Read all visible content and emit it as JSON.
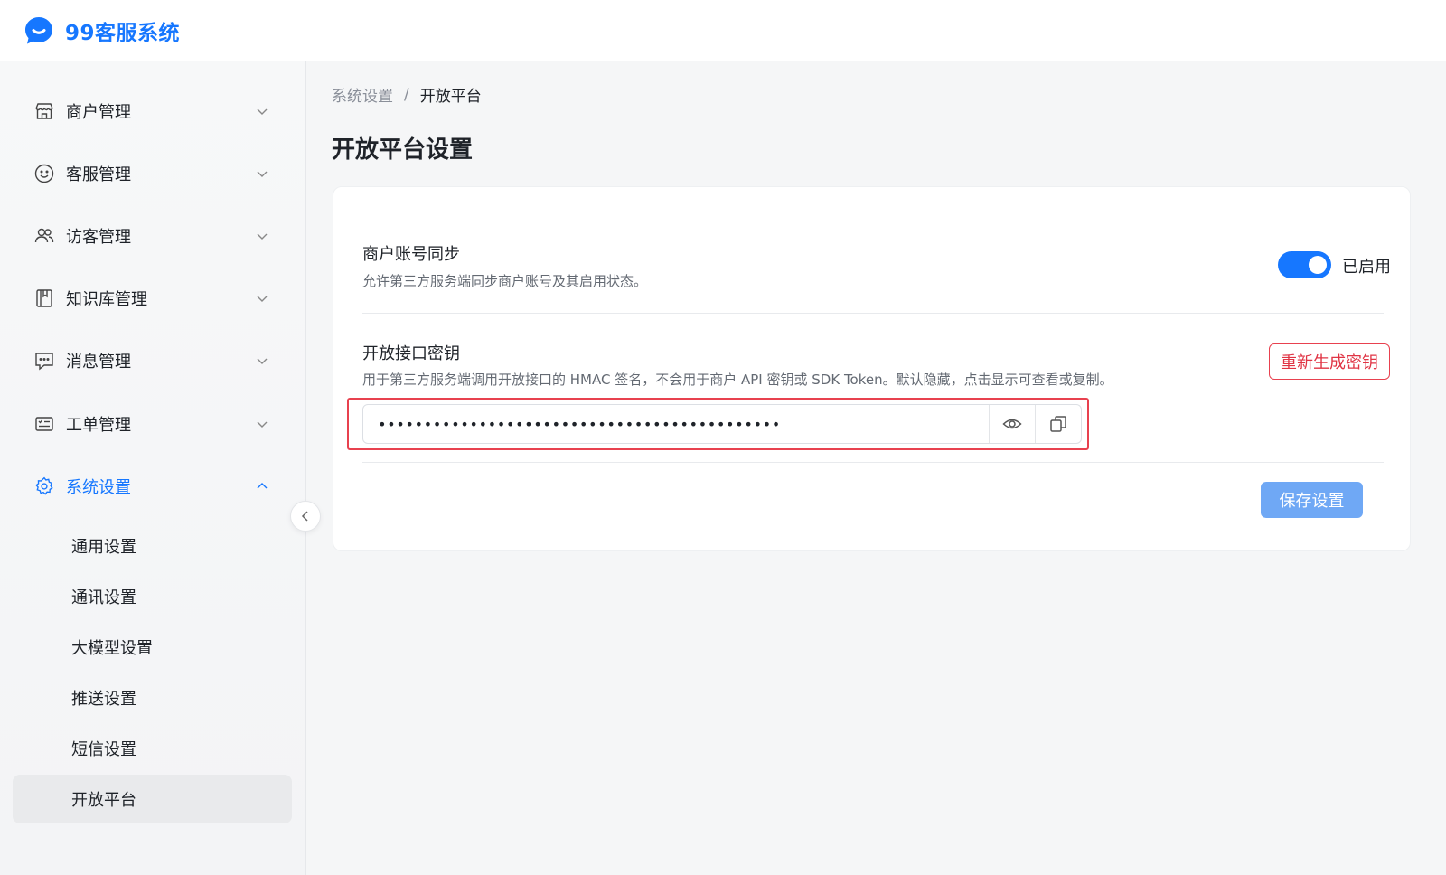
{
  "app": {
    "logo_text": "99客服系统"
  },
  "sidebar": {
    "menus": [
      {
        "label": "商户管理"
      },
      {
        "label": "客服管理"
      },
      {
        "label": "访客管理"
      },
      {
        "label": "知识库管理"
      },
      {
        "label": "消息管理"
      },
      {
        "label": "工单管理"
      },
      {
        "label": "系统设置"
      }
    ],
    "submenus": [
      {
        "label": "通用设置"
      },
      {
        "label": "通讯设置"
      },
      {
        "label": "大模型设置"
      },
      {
        "label": "推送设置"
      },
      {
        "label": "短信设置"
      },
      {
        "label": "开放平台"
      }
    ]
  },
  "breadcrumb": {
    "parent": "系统设置",
    "separator": "/",
    "current": "开放平台"
  },
  "page": {
    "title": "开放平台设置"
  },
  "sync": {
    "title": "商户账号同步",
    "description": "允许第三方服务端同步商户账号及其启用状态。",
    "enabled": true,
    "status_label": "已启用"
  },
  "api_key": {
    "title": "开放接口密钥",
    "description": "用于第三方服务端调用开放接口的 HMAC 签名，不会用于商户 API 密钥或 SDK Token。默认隐藏，点击显示可查看或复制。",
    "masked_value": "••••••••••••••••••••••••••••••••••••••••••••",
    "regenerate_label": "重新生成密钥"
  },
  "actions": {
    "save_label": "保存设置"
  },
  "colors": {
    "primary": "#1677ff",
    "danger": "#e8414f",
    "save_button": "#6fa8f5"
  }
}
